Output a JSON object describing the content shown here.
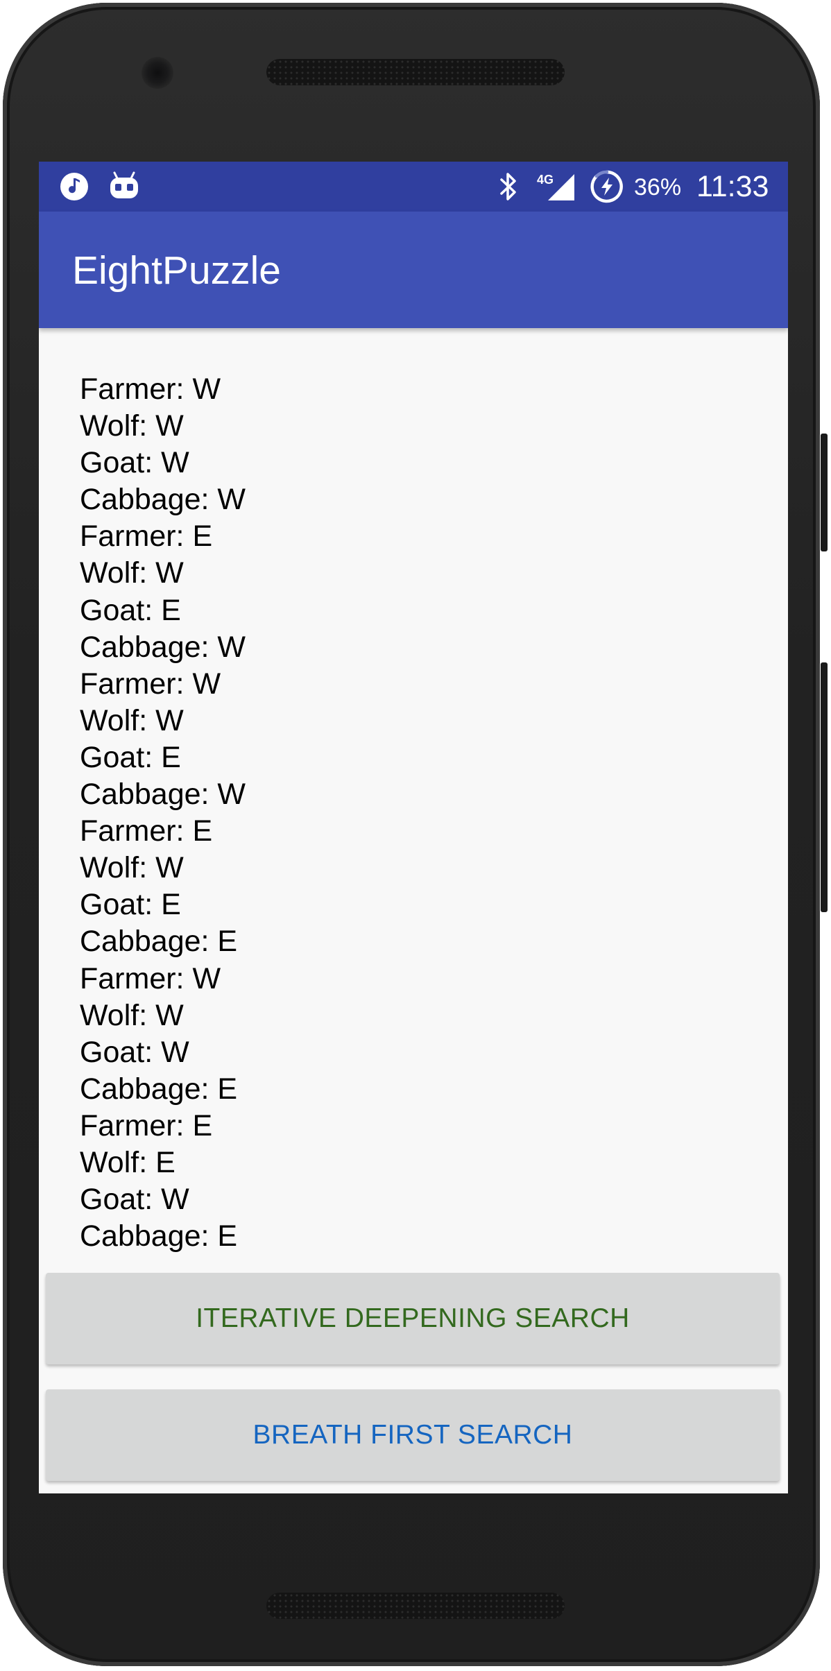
{
  "status_bar": {
    "battery_percent": "36%",
    "time": "11:33",
    "network_type": "4G",
    "icons": [
      "music-notification-icon",
      "android-debug-icon",
      "bluetooth-icon",
      "signal-4g-icon",
      "battery-saver-icon"
    ]
  },
  "app_bar": {
    "title": "EightPuzzle"
  },
  "output": {
    "lines": [
      "Farmer: W",
      "Wolf: W",
      "Goat: W",
      "Cabbage: W",
      "Farmer: E",
      "Wolf: W",
      "Goat: E",
      "Cabbage: W",
      "Farmer: W",
      "Wolf: W",
      "Goat: E",
      "Cabbage: W",
      "Farmer: E",
      "Wolf: W",
      "Goat: E",
      "Cabbage: E",
      "Farmer: W",
      "Wolf: W",
      "Goat: W",
      "Cabbage: E",
      "Farmer: E",
      "Wolf: E",
      "Goat: W",
      "Cabbage: E"
    ]
  },
  "buttons": {
    "iterative_deepening": "ITERATIVE DEEPENING SEARCH",
    "breath_first": "BREATH FIRST SEARCH"
  },
  "colors": {
    "status_bar": "#303f9f",
    "app_bar": "#3f51b5",
    "ids_button_text": "#33691e",
    "bfs_button_text": "#1565c0",
    "button_bg": "#d6d7d7"
  }
}
